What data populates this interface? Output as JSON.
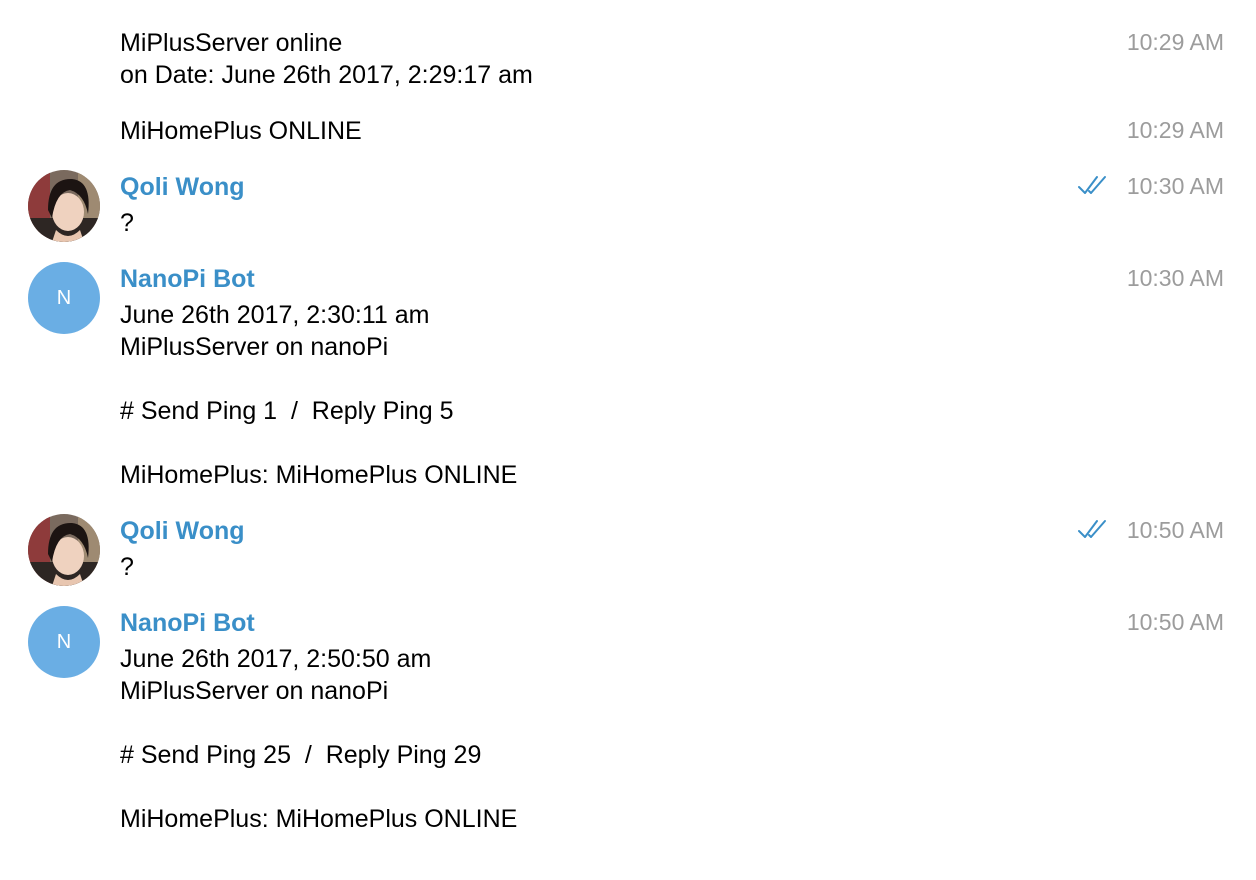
{
  "messages": [
    {
      "sender": "",
      "text": "MiPlusServer online\non Date: June 26th 2017, 2:29:17 am",
      "time": "10:29 AM"
    },
    {
      "sender": "",
      "text": "MiHomePlus ONLINE",
      "time": "10:29 AM"
    },
    {
      "sender": "Qoli Wong",
      "text": "?",
      "time": "10:30 AM",
      "read": true
    },
    {
      "sender": "NanoPi Bot",
      "avatar_letter": "N",
      "text": "June 26th 2017, 2:30:11 am\nMiPlusServer on nanoPi\n\n# Send Ping 1  /  Reply Ping 5\n\nMiHomePlus: MiHomePlus ONLINE",
      "time": "10:30 AM"
    },
    {
      "sender": "Qoli Wong",
      "text": "?",
      "time": "10:50 AM",
      "read": true
    },
    {
      "sender": "NanoPi Bot",
      "avatar_letter": "N",
      "text": "June 26th 2017, 2:50:50 am\nMiPlusServer on nanoPi\n\n# Send Ping 25  /  Reply Ping 29\n\nMiHomePlus: MiHomePlus ONLINE",
      "time": "10:50 AM"
    }
  ],
  "colors": {
    "sender_name": "#3a8fc8",
    "timestamp": "#9c9c9c",
    "bot_avatar": "#6aaee4",
    "read_checks": "#3a8fc8"
  },
  "icons": {
    "read_receipt": "double-check-icon",
    "user_avatar": "user-photo-avatar"
  }
}
